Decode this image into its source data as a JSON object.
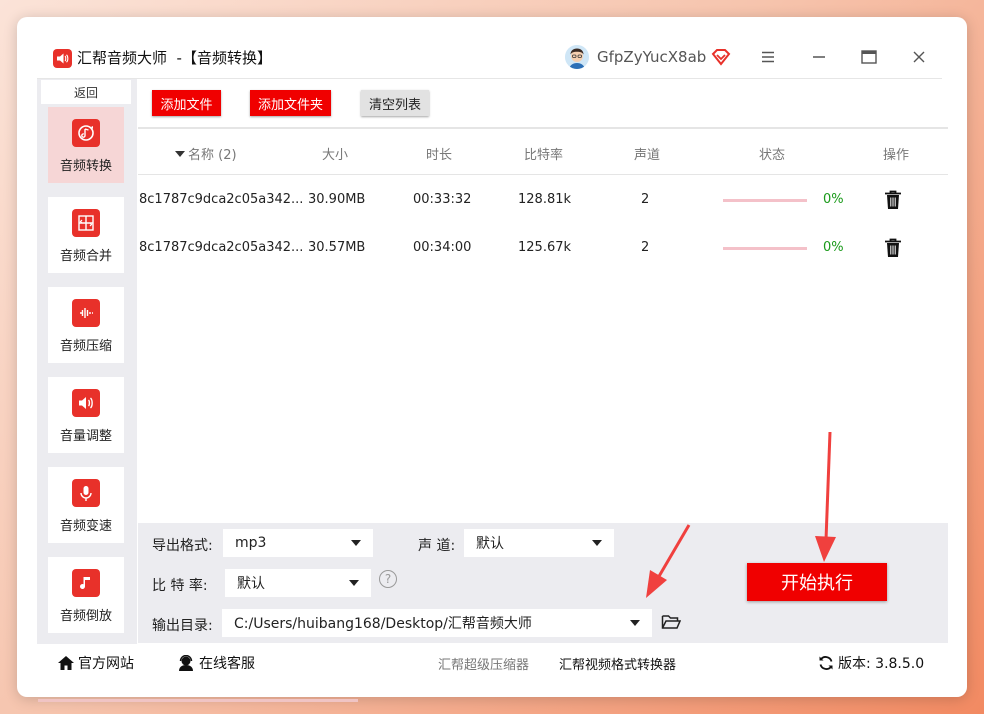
{
  "app": {
    "title": "汇帮音频大师  -【音频转换】",
    "username": "GfpZyYucX8ab",
    "brand_color": "#f00000"
  },
  "sidebar": {
    "back_label": "返回",
    "items": [
      {
        "label": "音频转换",
        "icon": "audio-convert-icon",
        "active": true
      },
      {
        "label": "音频合并",
        "icon": "audio-merge-icon",
        "active": false
      },
      {
        "label": "音频压缩",
        "icon": "audio-compress-icon",
        "active": false
      },
      {
        "label": "音量调整",
        "icon": "volume-icon",
        "active": false
      },
      {
        "label": "音频变速",
        "icon": "microphone-icon",
        "active": false
      },
      {
        "label": "音频倒放",
        "icon": "music-note-icon",
        "active": false
      }
    ]
  },
  "toolbar": {
    "add_file": "添加文件",
    "add_folder": "添加文件夹",
    "clear_list": "清空列表"
  },
  "table": {
    "columns": [
      "名称 (2)",
      "大小",
      "时长",
      "比特率",
      "声道",
      "状态",
      "操作"
    ],
    "rows": [
      {
        "name": "8c1787c9dca2c05a342...",
        "size": "30.90MB",
        "duration": "00:33:32",
        "bitrate": "128.81k",
        "channels": "2",
        "progress_text": "0%",
        "progress": 0
      },
      {
        "name": "8c1787c9dca2c05a342...",
        "size": "30.57MB",
        "duration": "00:34:00",
        "bitrate": "125.67k",
        "channels": "2",
        "progress_text": "0%",
        "progress": 0
      }
    ]
  },
  "settings": {
    "format_label": "导出格式:",
    "format_value": "mp3",
    "channel_label": "声 道:",
    "channel_value": "默认",
    "bitrate_label": "比 特 率:",
    "bitrate_value": "默认",
    "help": "?",
    "output_label": "输出目录:",
    "output_value": "C:/Users/huibang168/Desktop/汇帮音频大师",
    "start_label": "开始执行"
  },
  "footer": {
    "website": "官方网站",
    "support": "在线客服",
    "link1": "汇帮超级压缩器",
    "link2": "汇帮视频格式转换器",
    "version": "版本:  3.8.5.0"
  }
}
